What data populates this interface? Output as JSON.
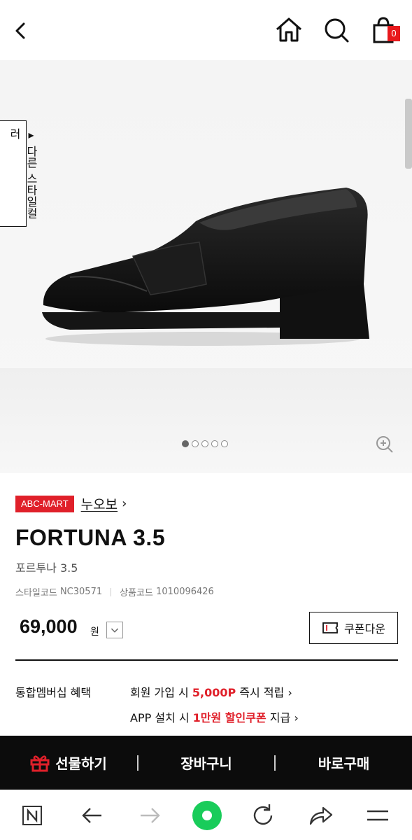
{
  "header": {
    "cart_count": "0"
  },
  "gallery": {
    "side_tab_label": "다른 스타일컬러",
    "dots": [
      true,
      false,
      false,
      false,
      false
    ]
  },
  "product": {
    "mall_badge": "ABC-MART",
    "brand": "누오보",
    "name": "FORTUNA 3.5",
    "name_ko": "포르투나 3.5",
    "style_code_label": "스타일코드",
    "style_code": "NC30571",
    "product_code_label": "상품코드",
    "product_code": "1010096426",
    "price": "69,000",
    "price_unit": "원",
    "coupon_button": "쿠폰다운"
  },
  "benefits": {
    "label": "통합멤버십 혜택",
    "line1_pre": "회원 가입 시 ",
    "line1_highlight": "5,000P",
    "line1_post": " 즉시 적립",
    "line2_pre": "APP 설치 시 ",
    "line2_highlight": "1만원 할인쿠폰",
    "line2_post": " 지급"
  },
  "actions": {
    "gift": "선물하기",
    "cart": "장바구니",
    "buy": "바로구매"
  },
  "colors": {
    "accent_red": "#e0202a",
    "action_bar": "#0c0c0c",
    "browser_green": "#19cc5a"
  }
}
